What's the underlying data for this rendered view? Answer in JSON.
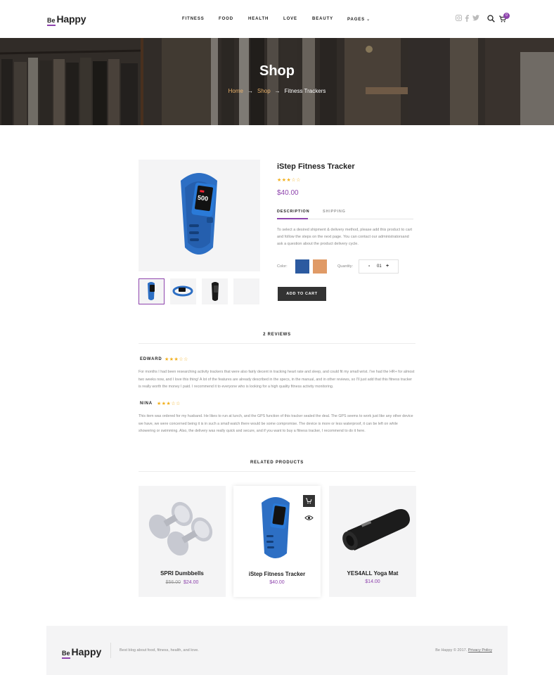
{
  "header": {
    "logo_be": "Be",
    "logo_happy": "Happy",
    "nav": [
      "FITNESS",
      "FOOD",
      "HEALTH",
      "LOVE",
      "BEAUTY",
      "PAGES"
    ],
    "cart_count": "0"
  },
  "hero": {
    "title": "Shop",
    "breadcrumb": [
      "Home",
      "Shop",
      "Fitness Trackers"
    ],
    "separator": "→"
  },
  "product": {
    "title": "iStep Fitness Tracker",
    "rating_stars": "★★★☆☆",
    "rating": 3.5,
    "price": "$40.00",
    "tabs": [
      "DESCRIPTION",
      "SHIPPING"
    ],
    "description": "To select a desired shipment & delivery method, please add this product to cart and follow the steps on the next page. You can contact our administratorsand ask a question about the product delivery cycle.",
    "color_label": "Color:",
    "colors": [
      "#2c5aa0",
      "#e09a66"
    ],
    "quantity_label": "Quantity:",
    "quantity": "01",
    "minus": "-",
    "plus": "+",
    "add_to_cart": "ADD TO CART"
  },
  "reviews": {
    "title": "2 REVIEWS",
    "items": [
      {
        "name": "EDWARD",
        "stars": "★★★☆☆",
        "text": "For months I had been researching activity trackers that were also fairly decent in tracking heart rate and sleep, and could fit my small wrist. I've had the HR+ for almost two weeks now, and I love this thing! A lot of the features are already described in the specs, in the manual, and in other reviews, so I'll just add that this fitness tracker is really worth the money I paid. I recommend it to everyone who is looking for a high quality fitness activity monitoring."
      },
      {
        "name": "NINA",
        "stars": "★★★☆☆",
        "text": "This item was ordered for my husband. He likes to run at lunch, and the GPS function of this tracker sealed the deal. The GPS seems to work just like any other device we have, we were concerned being it is in such a small watch there would be some compromise. The device is more or less waterproof, it can be left on while showering or swimming. Also, the delivery was really quick and secure, and if you want to buy a fitness tracker, I recommend to do it here."
      }
    ]
  },
  "related": {
    "title": "RELATED PRODUCTS",
    "items": [
      {
        "name": "SPRI Dumbbells",
        "old_price": "$56.00",
        "price": "$24.00"
      },
      {
        "name": "iStep Fitness Tracker",
        "old_price": "",
        "price": "$40.00"
      },
      {
        "name": "YES4ALL Yoga Mat",
        "old_price": "",
        "price": "$14.00"
      }
    ]
  },
  "footer": {
    "logo_be": "Be",
    "logo_happy": "Happy",
    "tagline": "Best blog about food, fitness, health, and love.",
    "copyright": "Be Happy © 2017.",
    "privacy": "Privacy Policy"
  },
  "colors": {
    "accent": "#8e44ad",
    "star": "#f2b01e",
    "dark_button": "#333333"
  }
}
